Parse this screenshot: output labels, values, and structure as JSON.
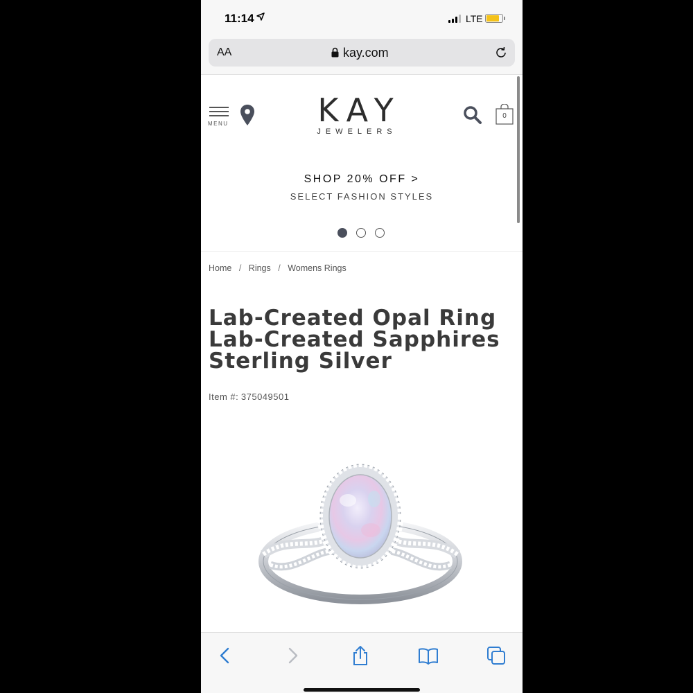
{
  "status_bar": {
    "time": "11:14",
    "network": "LTE"
  },
  "url_bar": {
    "text_size_label": "AA",
    "domain": "kay.com"
  },
  "header": {
    "menu_label": "MENU",
    "logo_main": "KAY",
    "logo_sub": "JEWELERS",
    "bag_count": "0"
  },
  "promo": {
    "headline": "SHOP 20% OFF >",
    "subhead": "SELECT FASHION STYLES",
    "carousel_total": 3,
    "carousel_active": 1
  },
  "breadcrumb": {
    "items": [
      "Home",
      "Rings",
      "Womens Rings"
    ],
    "separator": "/"
  },
  "product": {
    "title_lines": [
      "Lab-Created Opal Ring",
      "Lab-Created Sapphires",
      "Sterling Silver"
    ],
    "item_label": "Item #:",
    "item_number": "375049501"
  },
  "colors": {
    "accent": "#2f7dd1",
    "battery": "#f4c21a",
    "title": "#3a3a3a"
  },
  "toolbar": {
    "icons": [
      "back-icon",
      "forward-icon",
      "share-icon",
      "bookmarks-icon",
      "tabs-icon"
    ]
  }
}
